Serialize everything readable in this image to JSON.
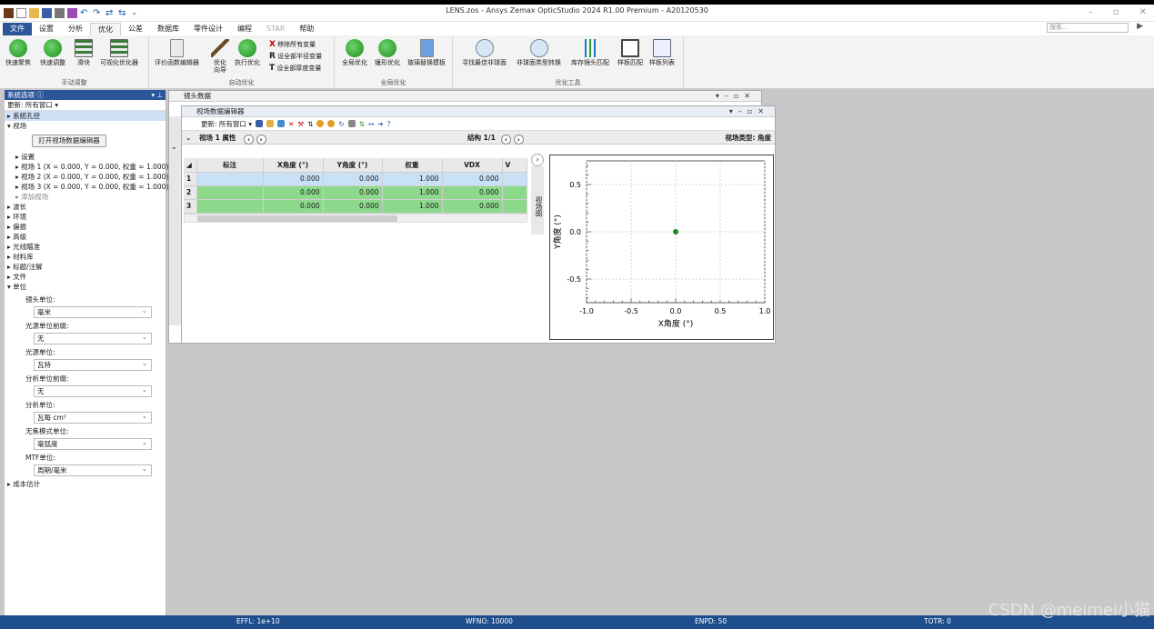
{
  "window": {
    "title": "LENS.zos - Ansys Zemax OpticStudio 2024 R1.00   Premium - A20120530"
  },
  "menu": {
    "tabs": [
      "文件",
      "设置",
      "分析",
      "优化",
      "公差",
      "数据库",
      "零件设计",
      "编程",
      "STAR",
      "帮助"
    ],
    "active": "优化",
    "search_placeholder": "搜索..."
  },
  "ribbon": {
    "manual": {
      "label": "手动调整",
      "buttons": [
        "快速聚焦",
        "快速调整",
        "滑块",
        "可视化优化器"
      ]
    },
    "auto": {
      "label": "自动优化",
      "buttons": [
        "评价函数编辑器",
        "优化\n向导",
        "执行优化"
      ],
      "small": [
        "移除所有变量",
        "设全部半径变量",
        "设全部厚度变量"
      ]
    },
    "global": {
      "label": "全局优化",
      "buttons": [
        "全局优化",
        "锤形优化",
        "玻璃替换模板"
      ]
    },
    "tools": {
      "label": "优化工具",
      "buttons": [
        "寻找最佳非球面",
        "非球面类型转换",
        "库存镜头匹配",
        "样板匹配",
        "样板列表"
      ]
    }
  },
  "left_panel": {
    "title": "系统选项",
    "update": "更新: 所有窗口 ▾",
    "tree_top": [
      "系统孔径",
      "视场"
    ],
    "open_btn": "打开视场数据编辑器",
    "fields": [
      "设置",
      "视场 1 (X = 0.000, Y = 0.000, 权重 = 1.000)",
      "视场 2 (X = 0.000, Y = 0.000, 权重 = 1.000)",
      "视场 3 (X = 0.000, Y = 0.000, 权重 = 1.000)",
      "添加视场"
    ],
    "tree_mid": [
      "波长",
      "环境",
      "偏振",
      "高级",
      "光线瞄准",
      "材料库",
      "标题/注解",
      "文件",
      "单位"
    ],
    "units": [
      {
        "label": "镜头单位:",
        "value": "毫米"
      },
      {
        "label": "光源单位前缀:",
        "value": "无"
      },
      {
        "label": "光源单位:",
        "value": "瓦特"
      },
      {
        "label": "分析单位前缀:",
        "value": "无"
      },
      {
        "label": "分析单位:",
        "value": "瓦每 cm²"
      },
      {
        "label": "无焦模式单位:",
        "value": "毫弧度"
      },
      {
        "label": "MTF单位:",
        "value": "周期/毫米"
      }
    ],
    "tree_end": "成本估计"
  },
  "lens_data": {
    "title": "镜头数据"
  },
  "field_editor": {
    "title": "视场数据编辑器",
    "update": "更新: 所有窗口 ▾",
    "header_left": "视场  1 属性",
    "config": "结构 1/1",
    "field_type": "视场类型: 角度",
    "side_tab": "视场图",
    "columns": [
      "标注",
      "X角度 (°)",
      "Y角度 (°)",
      "权重",
      "VDX",
      "V"
    ],
    "rows": [
      {
        "n": "1",
        "x": "0.000",
        "y": "0.000",
        "w": "1.000",
        "vdx": "0.000"
      },
      {
        "n": "2",
        "x": "0.000",
        "y": "0.000",
        "w": "1.000",
        "vdx": "0.000"
      },
      {
        "n": "3",
        "x": "0.000",
        "y": "0.000",
        "w": "1.000",
        "vdx": "0.000"
      }
    ]
  },
  "chart_data": {
    "type": "scatter",
    "xlabel": "X角度 (°)",
    "ylabel": "Y角度 (°)",
    "xlim": [
      -1.0,
      1.0
    ],
    "ylim": [
      -0.75,
      0.75
    ],
    "xticks": [
      "-1.0",
      "-0.5",
      "0.0",
      "0.5",
      "1.0"
    ],
    "yticks": [
      "0.5",
      "0.0",
      "-0.5"
    ],
    "grid": true,
    "points": [
      {
        "x": 0.0,
        "y": 0.0
      }
    ],
    "point_color": "#1a8a1a"
  },
  "status": {
    "effl": "EFFL: 1e+10",
    "wfno": "WFNO: 10000",
    "enpd": "ENPD: 50",
    "totr": "TOTR: 0"
  },
  "watermark": "CSDN @meimei小猫"
}
